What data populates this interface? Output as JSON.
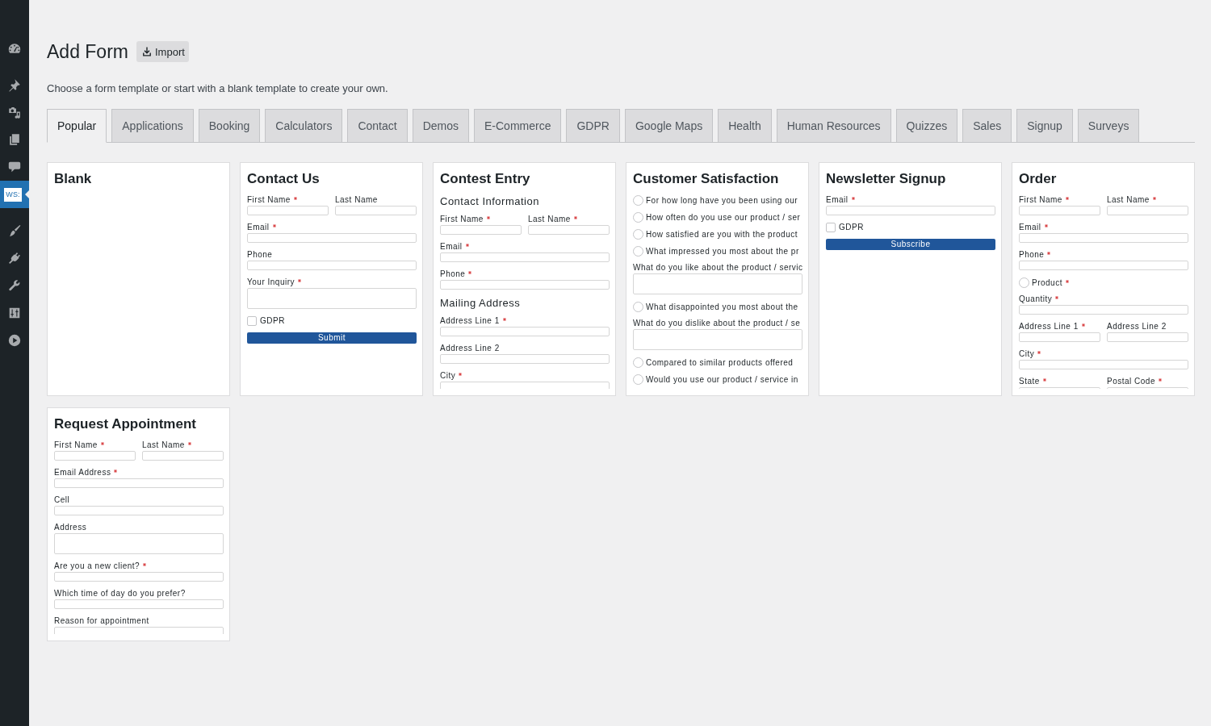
{
  "sidebar": {
    "groups": [
      {
        "items": [
          {
            "kind": "icon",
            "selected": false
          }
        ]
      },
      {
        "items": [
          {
            "kind": "icon",
            "selected": false
          },
          {
            "kind": "icon",
            "selected": false
          },
          {
            "kind": "icon",
            "selected": false
          },
          {
            "kind": "icon",
            "selected": false
          },
          {
            "kind": "logo",
            "text": "WS:",
            "selected": true
          }
        ]
      },
      {
        "items": [
          {
            "kind": "icon",
            "selected": false
          },
          {
            "kind": "icon",
            "selected": false
          },
          {
            "kind": "icon",
            "selected": false
          },
          {
            "kind": "icon",
            "selected": false
          },
          {
            "kind": "icon",
            "selected": false
          }
        ]
      }
    ]
  },
  "header": {
    "title": "Add Form",
    "import_button": "Import",
    "description": "Choose a form template or start with a blank template to create your own."
  },
  "tabs": [
    {
      "label": "Popular",
      "selected": true
    },
    {
      "label": "Applications",
      "selected": false
    },
    {
      "label": "Booking",
      "selected": false
    },
    {
      "label": "Calculators",
      "selected": false
    },
    {
      "label": "Contact",
      "selected": false
    },
    {
      "label": "Demos",
      "selected": false
    },
    {
      "label": "E-Commerce",
      "selected": false
    },
    {
      "label": "GDPR",
      "selected": false
    },
    {
      "label": "Google Maps",
      "selected": false
    },
    {
      "label": "Health",
      "selected": false
    },
    {
      "label": "Human Resources",
      "selected": false
    },
    {
      "label": "Quizzes",
      "selected": false
    },
    {
      "label": "Sales",
      "selected": false
    },
    {
      "label": "Signup",
      "selected": false
    },
    {
      "label": "Surveys",
      "selected": false
    }
  ],
  "templates": [
    {
      "title": "Blank"
    },
    {
      "title": "Contact Us",
      "fields": [
        {
          "kind": "row",
          "fields": [
            {
              "kind": "text",
              "label": "First Name",
              "required": true
            },
            {
              "kind": "text",
              "label": "Last Name",
              "required": false
            }
          ]
        },
        {
          "kind": "text",
          "label": "Email",
          "required": true
        },
        {
          "kind": "text",
          "label": "Phone",
          "required": false
        },
        {
          "kind": "textarea",
          "label": "Your Inquiry",
          "required": true
        },
        {
          "kind": "checkbox",
          "label": "GDPR",
          "checked": false
        },
        {
          "kind": "button",
          "label": "Submit"
        }
      ]
    },
    {
      "title": "Contest Entry",
      "fields": [
        {
          "kind": "section",
          "label": "Contact Information"
        },
        {
          "kind": "row",
          "fields": [
            {
              "kind": "text",
              "label": "First Name",
              "required": true
            },
            {
              "kind": "text",
              "label": "Last Name",
              "required": true
            }
          ]
        },
        {
          "kind": "text",
          "label": "Email",
          "required": true
        },
        {
          "kind": "text",
          "label": "Phone",
          "required": true
        },
        {
          "kind": "section",
          "label": "Mailing Address"
        },
        {
          "kind": "text",
          "label": "Address Line 1",
          "required": true
        },
        {
          "kind": "text",
          "label": "Address Line 2",
          "required": false
        },
        {
          "kind": "text",
          "label": "City",
          "required": true
        }
      ]
    },
    {
      "title": "Customer Satisfaction",
      "fields": [
        {
          "kind": "radio",
          "label": "For how long have you been using our",
          "selected": false
        },
        {
          "kind": "radio",
          "label": "How often do you use our product / ser",
          "selected": false
        },
        {
          "kind": "radio",
          "label": "How satisfied are you with the product",
          "selected": false
        },
        {
          "kind": "radio",
          "label": "What impressed you most about the pr",
          "selected": false
        },
        {
          "kind": "textarea",
          "label": "What do you like about the product / servic"
        },
        {
          "kind": "radio",
          "label": "What disappointed you most about the",
          "selected": false
        },
        {
          "kind": "textarea",
          "label": "What do you dislike about the product / se"
        },
        {
          "kind": "radio",
          "label": "Compared to similar products offered",
          "selected": false
        },
        {
          "kind": "radio",
          "label": "Would you use our product / service in",
          "selected": false
        }
      ]
    },
    {
      "title": "Newsletter Signup",
      "fields": [
        {
          "kind": "text",
          "label": "Email",
          "required": true
        },
        {
          "kind": "checkbox",
          "label": "GDPR",
          "checked": false
        },
        {
          "kind": "button",
          "label": "Subscribe"
        }
      ]
    },
    {
      "title": "Order",
      "fields": [
        {
          "kind": "row",
          "fields": [
            {
              "kind": "text",
              "label": "First Name",
              "required": true
            },
            {
              "kind": "text",
              "label": "Last Name",
              "required": true
            }
          ]
        },
        {
          "kind": "text",
          "label": "Email",
          "required": true
        },
        {
          "kind": "text",
          "label": "Phone",
          "required": true
        },
        {
          "kind": "radio",
          "label": "Product",
          "required": true,
          "selected": false
        },
        {
          "kind": "text",
          "label": "Quantity",
          "required": true
        },
        {
          "kind": "row",
          "fields": [
            {
              "kind": "text",
              "label": "Address Line 1",
              "required": true
            },
            {
              "kind": "text",
              "label": "Address Line 2",
              "required": false
            }
          ]
        },
        {
          "kind": "text",
          "label": "City",
          "required": true
        },
        {
          "kind": "row",
          "fields": [
            {
              "kind": "text",
              "label": "State",
              "required": true
            },
            {
              "kind": "text",
              "label": "Postal Code",
              "required": true
            }
          ]
        }
      ]
    },
    {
      "title": "Request Appointment",
      "fields": [
        {
          "kind": "row",
          "fields": [
            {
              "kind": "text",
              "label": "First Name",
              "required": true
            },
            {
              "kind": "text",
              "label": "Last Name",
              "required": true
            }
          ]
        },
        {
          "kind": "text",
          "label": "Email Address",
          "required": true
        },
        {
          "kind": "text",
          "label": "Cell",
          "required": false
        },
        {
          "kind": "textarea",
          "label": "Address",
          "required": false
        },
        {
          "kind": "text",
          "label": "Are you a new client?",
          "required": true
        },
        {
          "kind": "text",
          "label": "Which time of day do you prefer?",
          "required": false
        },
        {
          "kind": "text",
          "label": "Reason for appointment",
          "required": false
        }
      ]
    }
  ]
}
